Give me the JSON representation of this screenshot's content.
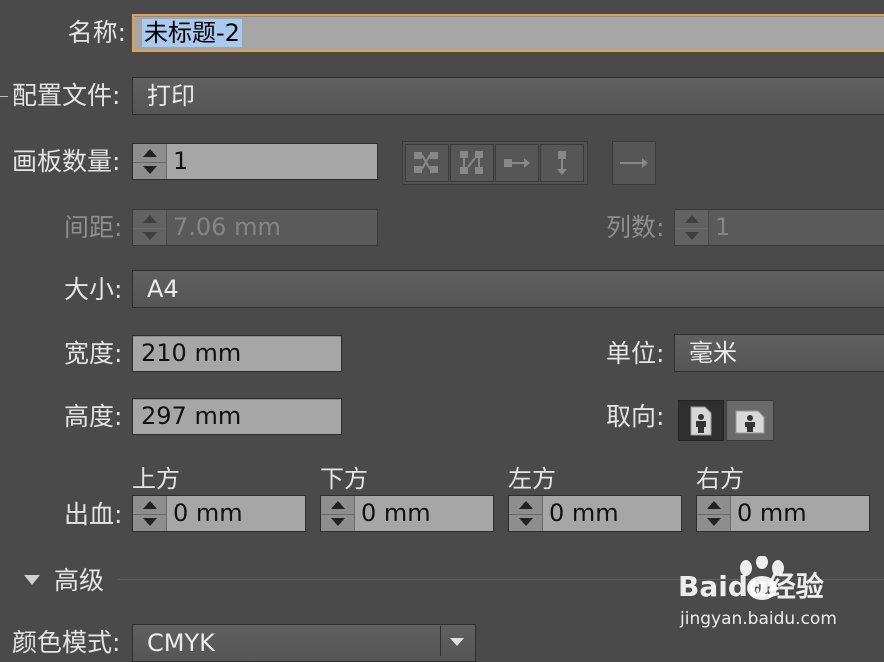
{
  "name_field": {
    "label": "名称:",
    "value": "未标题-2"
  },
  "profile": {
    "label": "配置文件:",
    "value": "打印"
  },
  "artboards": {
    "label": "画板数量:",
    "value": "1"
  },
  "spacing": {
    "label": "间距:",
    "value": "7.06 mm"
  },
  "columns": {
    "label": "列数:",
    "value": "1"
  },
  "size": {
    "label": "大小:",
    "value": "A4"
  },
  "width": {
    "label": "宽度:",
    "value": "210 mm"
  },
  "height": {
    "label": "高度:",
    "value": "297 mm"
  },
  "units": {
    "label": "单位:",
    "value": "毫米"
  },
  "orientation": {
    "label": "取向:"
  },
  "bleed": {
    "label": "出血:",
    "top": {
      "label": "上方",
      "value": "0 mm"
    },
    "bottom": {
      "label": "下方",
      "value": "0 mm"
    },
    "left": {
      "label": "左方",
      "value": "0 mm"
    },
    "right": {
      "label": "右方",
      "value": "0 mm"
    }
  },
  "advanced": {
    "label": "高级"
  },
  "color_mode": {
    "label": "颜色模式:",
    "value": "CMYK"
  },
  "watermark": {
    "brand_text": "Baidu经验",
    "url": "jingyan.baidu.com"
  },
  "colors": {
    "field_bg": "#a6a6a6",
    "panel_bg": "#4a4a4a",
    "focus": "#e2a04a",
    "selection": "#a9c9ef"
  }
}
